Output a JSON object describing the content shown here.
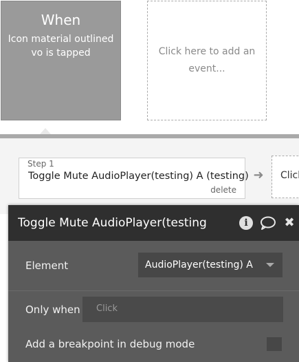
{
  "event": {
    "when": "When",
    "description": "Icon material outlined vo is tapped",
    "add_event": "Click here to add an event..."
  },
  "step": {
    "label": "Step 1",
    "title": "Toggle Mute AudioPlayer(testing) A (testing)",
    "delete": "delete",
    "next_label": "Click"
  },
  "editor": {
    "title": "Toggle Mute AudioPlayer(testing",
    "element_label": "Element",
    "element_value": "AudioPlayer(testing) A",
    "only_when_label": "Only when",
    "only_when_placeholder": "Click",
    "breakpoint_label": "Add a breakpoint in debug mode",
    "icons": [
      "info-icon",
      "comment-icon",
      "close-icon"
    ]
  }
}
